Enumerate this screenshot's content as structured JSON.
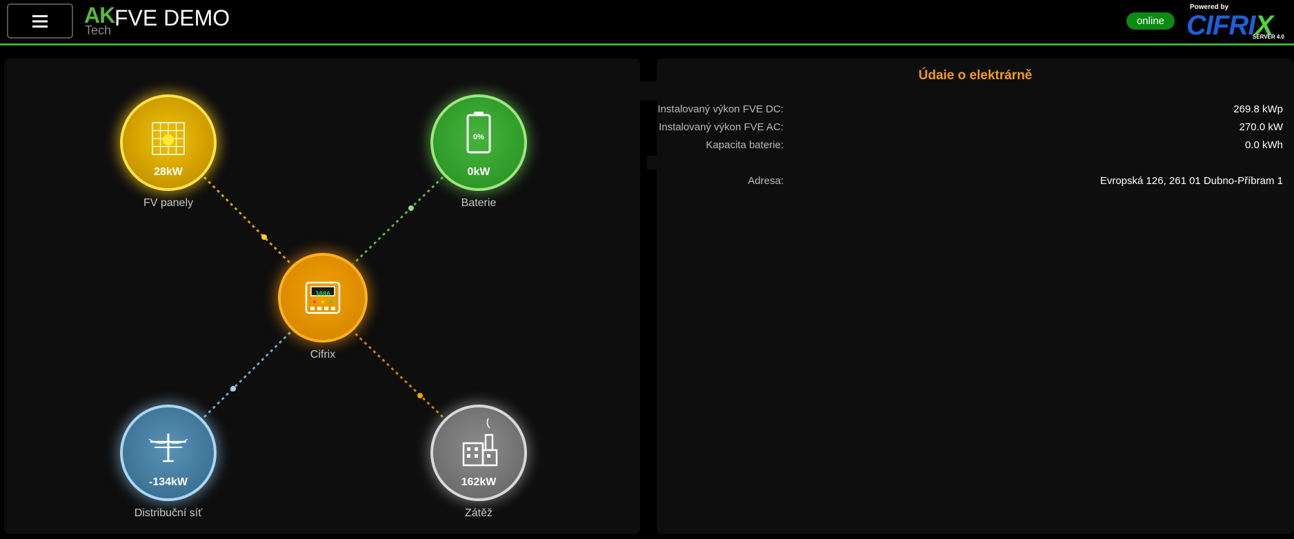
{
  "header": {
    "logo_top": "AK",
    "logo_bottom": "Tech",
    "title": "FVE DEMO",
    "status": "online",
    "powered_by": "Powered by",
    "brand": "CIFRIX",
    "brand_sub": "SERVER 4.0"
  },
  "flow": {
    "pv": {
      "value": "28kW",
      "label": "FV panely"
    },
    "battery": {
      "value": "0kW",
      "label": "Baterie",
      "soc": "0%"
    },
    "inverter": {
      "label": "Cifrix",
      "display": "3086"
    },
    "grid": {
      "value": "-134kW",
      "label": "Distribuční síť"
    },
    "load": {
      "value": "162kW",
      "label": "Zátěž"
    }
  },
  "info": {
    "title": "Údaie o elektrárně",
    "rows": [
      {
        "key": "Instalovaný výkon FVE DC:",
        "value": "269.8 kWp"
      },
      {
        "key": "Instalovaný výkon FVE AC:",
        "value": "270.0 kW"
      },
      {
        "key": "Kapacita baterie:",
        "value": "0.0 kWh"
      },
      {
        "key": "Adresa:",
        "value": "Evropská 126, 261 01 Dubno-Příbram 1"
      }
    ]
  },
  "colors": {
    "accent": "#3fae3a",
    "title_orange": "#f29b1a",
    "pv": "#ffd21e",
    "battery": "#6fcf5a",
    "inverter": "#f2a200",
    "grid": "#7fb8d8",
    "load": "#d98a00"
  }
}
